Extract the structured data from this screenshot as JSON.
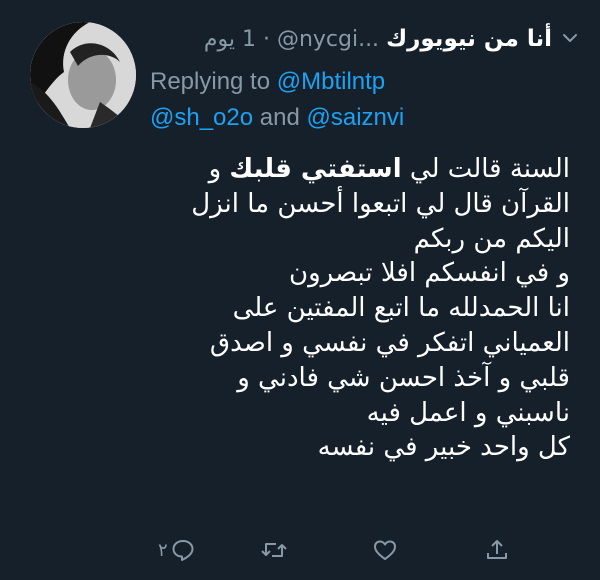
{
  "tweet": {
    "author_name": "أنا من نيويورك",
    "handle": "@nycgi...",
    "separator": "·",
    "time": "1 يوم",
    "replying_prefix": "Replying to",
    "replying_to": [
      "@Mbtilntp",
      "@sh_o2o",
      "@saiznvi"
    ],
    "replying_and": "and",
    "body_lines": [
      "السنة قالت لي استفتي قلبك و",
      "القرآن قال لي اتبعوا أحسن ما انزل",
      "اليكم من ربكم",
      "و في انفسكم افلا تبصرون",
      "انا الحمدلله ما اتبع المفتين على",
      "العمياني اتفكر في نفسي و اصدق",
      "قلبي و آخذ احسن شي فادني و",
      "ناسبني و اعمل فيه",
      "كل واحد خبير في نفسه"
    ],
    "bold_phrase": "استفتي قلبك",
    "reply_count": "٢"
  },
  "icons": {
    "menu": "chevron-down-icon",
    "reply": "reply-icon",
    "retweet": "retweet-icon",
    "like": "heart-icon",
    "share": "share-icon",
    "avatar": "avatar-photo"
  },
  "colors": {
    "background": "#15202b",
    "text": "#ffffff",
    "muted": "#8899a6",
    "link": "#1da1f2"
  }
}
